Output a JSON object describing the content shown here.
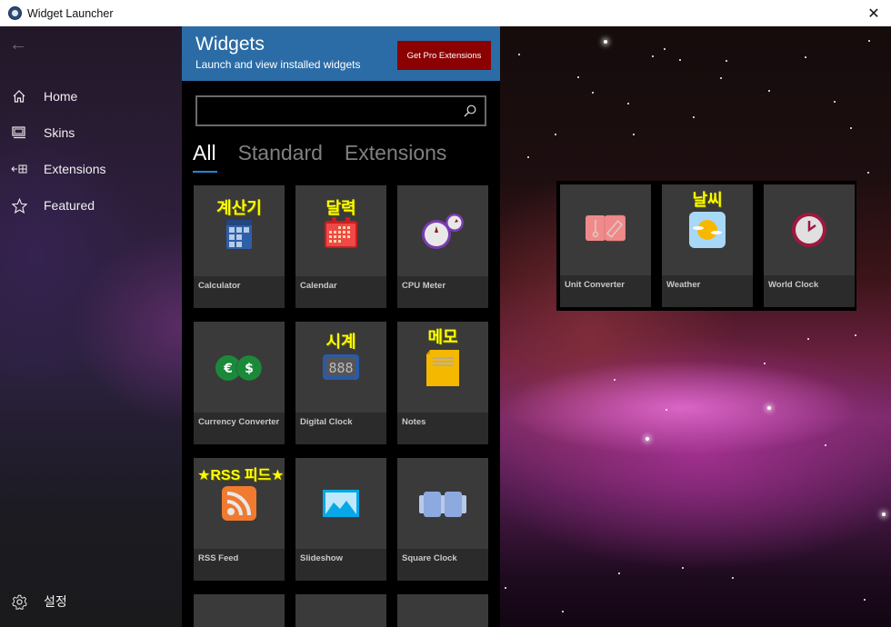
{
  "window": {
    "title": "Widget Launcher",
    "close_label": "✕"
  },
  "sidebar": {
    "back_label": "←",
    "items": [
      {
        "label": "Home",
        "icon": "home-icon",
        "glyph": "⌂"
      },
      {
        "label": "Skins",
        "icon": "skins-icon",
        "glyph": "▭"
      },
      {
        "label": "Extensions",
        "icon": "extensions-icon",
        "glyph": "←⊞"
      },
      {
        "label": "Featured",
        "icon": "star-icon",
        "glyph": "☆"
      }
    ],
    "settings": {
      "label": "설정",
      "icon": "gear-icon",
      "glyph": "⚙"
    }
  },
  "panel": {
    "title": "Widgets",
    "subtitle": "Launch and view installed widgets",
    "pro_button": "Get Pro Extensions",
    "search": {
      "value": "",
      "placeholder": ""
    },
    "tabs": [
      {
        "label": "All",
        "active": true
      },
      {
        "label": "Standard",
        "active": false
      },
      {
        "label": "Extensions",
        "active": false
      }
    ],
    "widgets": [
      {
        "name": "Calculator",
        "annotation": "계산기",
        "icon": "calculator-icon"
      },
      {
        "name": "Calendar",
        "annotation": "달력",
        "icon": "calendar-icon"
      },
      {
        "name": "CPU Meter",
        "annotation": "",
        "icon": "cpu-meter-icon"
      },
      {
        "name": "Currency Converter",
        "annotation": "",
        "icon": "currency-icon"
      },
      {
        "name": "Digital Clock",
        "annotation": "시계",
        "icon": "digital-clock-icon"
      },
      {
        "name": "Notes",
        "annotation": "메모",
        "icon": "notes-icon"
      },
      {
        "name": "RSS Feed",
        "annotation": "★RSS 피드★",
        "icon": "rss-icon"
      },
      {
        "name": "Slideshow",
        "annotation": "",
        "icon": "slideshow-icon"
      },
      {
        "name": "Square Clock",
        "annotation": "",
        "icon": "square-clock-icon"
      }
    ]
  },
  "desktop": {
    "running_widgets": [
      {
        "name": "Unit Converter",
        "annotation": "",
        "icon": "unit-converter-icon"
      },
      {
        "name": "Weather",
        "annotation": "날씨",
        "icon": "weather-icon"
      },
      {
        "name": "World Clock",
        "annotation": "",
        "icon": "world-clock-icon"
      }
    ]
  },
  "colors": {
    "header_blue": "#2b6ca6",
    "pro_red": "#8b0000",
    "tab_underline": "#1e88d4",
    "annotation_yellow": "#ffff00"
  }
}
